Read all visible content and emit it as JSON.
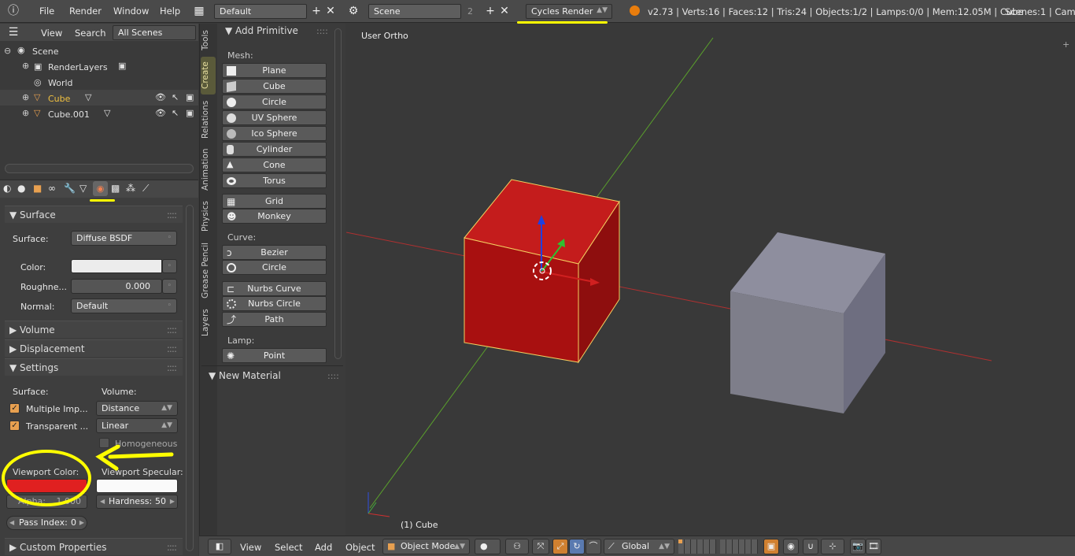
{
  "top_menu": [
    "File",
    "Render",
    "Window",
    "Help"
  ],
  "screen_layout": "Default",
  "scene_name": "Scene",
  "scene_count": "2",
  "render_engine": "Cycles Render",
  "status": "v2.73 | Verts:16 | Faces:12 | Tris:24 | Objects:1/2 | Lamps:0/0 | Mem:12.05M | Cube",
  "scenes_status": "Scenes:1 | Camer",
  "outliner": {
    "menu": [
      "View",
      "Search"
    ],
    "display_mode": "All Scenes",
    "items": [
      "Scene",
      "RenderLayers",
      "World",
      "Cube",
      "Cube.001"
    ]
  },
  "tool_tabs": [
    "Tools",
    "Create",
    "Relations",
    "Animation",
    "Physics",
    "Grease Pencil",
    "Layers"
  ],
  "add_primitive": {
    "title": "Add Primitive",
    "mesh_label": "Mesh:",
    "mesh": [
      "Plane",
      "Cube",
      "Circle",
      "UV Sphere",
      "Ico Sphere",
      "Cylinder",
      "Cone",
      "Torus"
    ],
    "extra": [
      "Grid",
      "Monkey"
    ],
    "curve_label": "Curve:",
    "curve": [
      "Bezier",
      "Circle",
      "Nurbs Curve",
      "Nurbs Circle",
      "Path"
    ],
    "lamp_label": "Lamp:",
    "lamp": [
      "Point"
    ]
  },
  "new_material_title": "New Material",
  "viewport_label": "User Ortho",
  "object_label": "(1) Cube",
  "properties": {
    "surface_section": "Surface",
    "surface_label": "Surface:",
    "surface_value": "Diffuse BSDF",
    "color_label": "Color:",
    "roughness_label": "Roughne...",
    "roughness_value": "0.000",
    "normal_label": "Normal:",
    "normal_value": "Default",
    "volume_section": "Volume",
    "displacement_section": "Displacement",
    "settings_section": "Settings",
    "settings_surface_label": "Surface:",
    "settings_volume_label": "Volume:",
    "multiple_imp": "Multiple Imp...",
    "transparent": "Transparent ...",
    "volume_sampling": "Distance",
    "volume_interp": "Linear",
    "homogeneous": "Homogeneous",
    "viewport_color_label": "Viewport Color:",
    "viewport_color": "#e02020",
    "viewport_specular_label": "Viewport Specular:",
    "alpha_label": "Alpha:",
    "alpha_value": "1.000",
    "hardness_label": "Hardness:",
    "hardness_value": "50",
    "pass_index_label": "Pass Index:",
    "pass_index_value": "0",
    "custom_props_section": "Custom Properties"
  },
  "bottom_bar": {
    "menu": [
      "View",
      "Select",
      "Add",
      "Object"
    ],
    "mode": "Object Mode",
    "orientation": "Global"
  },
  "colors": {
    "annotation": "#ffff00",
    "selected_text": "#f0c040",
    "cube_red": "#c01818",
    "cube_grey": "#8e8e9e"
  }
}
